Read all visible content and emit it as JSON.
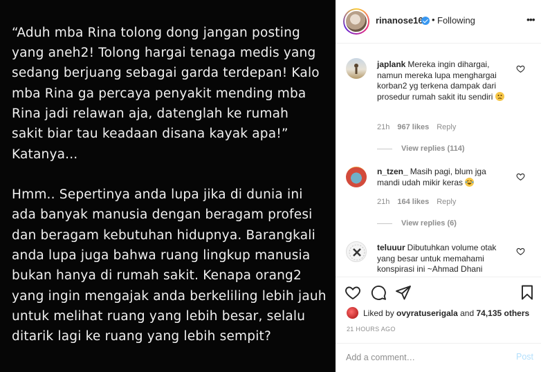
{
  "post": {
    "lines": [
      "“Aduh mba Rina tolong dong jangan posting",
      "yang aneh2! Tolong hargai tenaga medis yang",
      "sedang berjuang sebagai garda terdepan! Kalo",
      "mba Rina ga percaya penyakit mending mba",
      "Rina jadi relawan aja, datenglah ke rumah",
      "sakit biar tau keadaan disana kayak apa!”",
      "Katanya...",
      "Hmm.. Sepertinya anda lupa jika di dunia ini",
      "ada banyak manusia dengan beragam profesi",
      "dan beragam kebutuhan hidupnya. Barangkali",
      "anda lupa juga bahwa ruang lingkup manusia",
      "bukan hanya di rumah sakit. Kenapa orang2",
      "yang ingin mengajak anda berkeliling lebih jauh",
      "untuk melihat ruang yang lebih besar, selalu",
      "ditarik lagi ke ruang yang lebih sempit?"
    ]
  },
  "header": {
    "username": "rinanose16",
    "separator": "•",
    "follow_label": "Following",
    "more_icon": "more-options-icon"
  },
  "comments": [
    {
      "username": "japlank",
      "text": "Mereka ingin dihargai, namun mereka lupa menghargai korban2 yg terkena dampak dari prosedur rumah sakit itu sendiri",
      "emoji": "confused-face-emoji",
      "time": "21h",
      "likes": "967 likes",
      "reply_label": "Reply",
      "view_replies": "View replies (114)"
    },
    {
      "username": "n_tzen_",
      "text": "Masih pagi, blum jga mandi udah mikir keras",
      "emoji": "laughing-face-emoji",
      "time": "21h",
      "likes": "164 likes",
      "reply_label": "Reply",
      "view_replies": "View replies (6)"
    },
    {
      "username": "teluuur",
      "text": "Dibutuhkan volume otak yang besar untuk memahami konspirasi ini ~Ahmad Dhani"
    }
  ],
  "actions": {
    "liked_by_prefix": "Liked by",
    "liked_by_user": "ovyratuserigala",
    "and_label": "and",
    "others": "74,135 others",
    "timestamp": "21 HOURS AGO"
  },
  "add_comment": {
    "placeholder": "Add a comment…",
    "post_label": "Post"
  },
  "colors": {
    "post_background": "#060606",
    "post_text": "#f1f1f1",
    "verified": "#3897f0",
    "post_button_disabled": "#b2dffc",
    "muted": "#8e8e8e"
  }
}
